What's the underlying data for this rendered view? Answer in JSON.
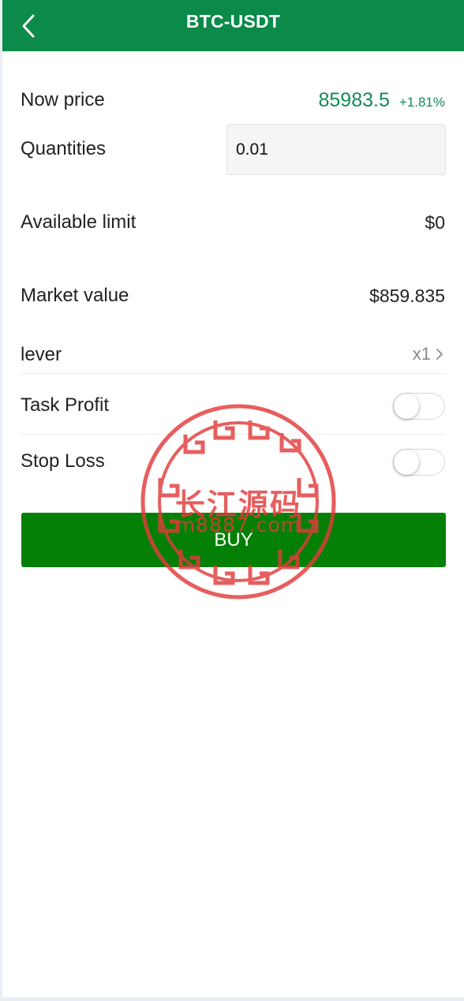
{
  "header": {
    "title": "BTC-USDT",
    "back_icon": "chevron-left-icon"
  },
  "now_price": {
    "label": "Now price",
    "value": "85983.5",
    "change": "+1.81%",
    "color": "#128a55"
  },
  "quantities": {
    "label": "Quantities",
    "value": "0.01"
  },
  "available_limit": {
    "label": "Available limit",
    "value": "$0"
  },
  "market_value": {
    "label": "Market value",
    "value": "$859.835"
  },
  "lever": {
    "label": "lever",
    "value": "x1",
    "icon": "chevron-right-icon"
  },
  "task_profit": {
    "label": "Task Profit",
    "enabled": false
  },
  "stop_loss": {
    "label": "Stop Loss",
    "enabled": false
  },
  "buy_button": {
    "label": "BUY",
    "color": "#058006"
  },
  "watermark": {
    "title": "长江源码",
    "subtitle": "m8887.com",
    "color": "#e23b3b"
  },
  "colors": {
    "header": "#0b8a4a",
    "background": "#e9edf4"
  }
}
